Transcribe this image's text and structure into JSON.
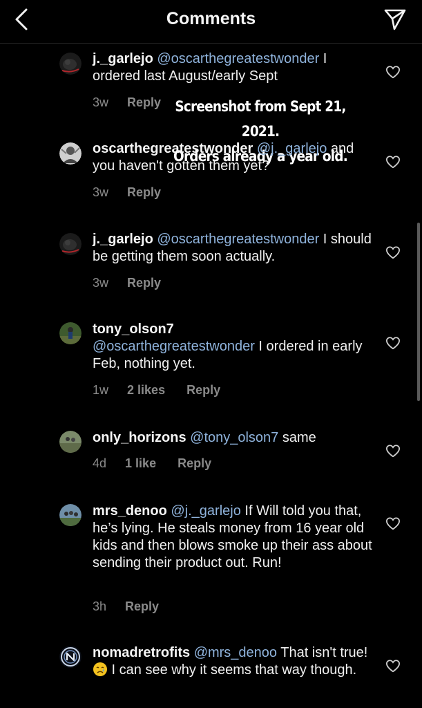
{
  "header": {
    "title": "Comments",
    "back_icon": "chevron-left-icon",
    "send_icon": "send-icon"
  },
  "overlay": {
    "line1": "Screenshot from Sept 21, 2021.",
    "line2": "Orders already a year old."
  },
  "comments": [
    {
      "username": "j._garlejo",
      "mention": "@oscarthegreatestwonder",
      "text": " I ordered last August/early Sept",
      "time": "3w",
      "likes": "",
      "reply": "Reply"
    },
    {
      "username": "oscarthegreatestwonder",
      "mention": "@j._garlejo",
      "text": " and you haven't gotten them yet?",
      "time": "3w",
      "likes": "",
      "reply": "Reply"
    },
    {
      "username": "j._garlejo",
      "mention": "@oscarthegreatestwonder",
      "text": " I should be getting them soon actually.",
      "time": "3w",
      "likes": "",
      "reply": "Reply"
    },
    {
      "username": "tony_olson7",
      "mention": "@oscarthegreatestwonder",
      "text": " I ordered in early Feb, nothing yet.",
      "time": "1w",
      "likes": "2 likes",
      "reply": "Reply"
    },
    {
      "username": "only_horizons",
      "mention": "@tony_olson7",
      "text": " same",
      "time": "4d",
      "likes": "1 like",
      "reply": "Reply"
    },
    {
      "username": "mrs_denoo",
      "mention": "@j._garlejo",
      "text": " If Will told you that, he’s lying.  He steals money from 16 year old kids and then blows smoke up their ass about sending their product out.  Run!",
      "time": "3h",
      "likes": "",
      "reply": "Reply"
    },
    {
      "username": "nomadretrofits",
      "mention": "@mrs_denoo",
      "text_before_emoji": " That isn't true! ",
      "emoji": "crying-face-emoji",
      "text": " I can see why it seems that way though.",
      "time": "",
      "likes": "",
      "reply": ""
    }
  ],
  "colors": {
    "background": "#000000",
    "mention": "#8fb3dc",
    "meta": "#8a8a8a"
  }
}
